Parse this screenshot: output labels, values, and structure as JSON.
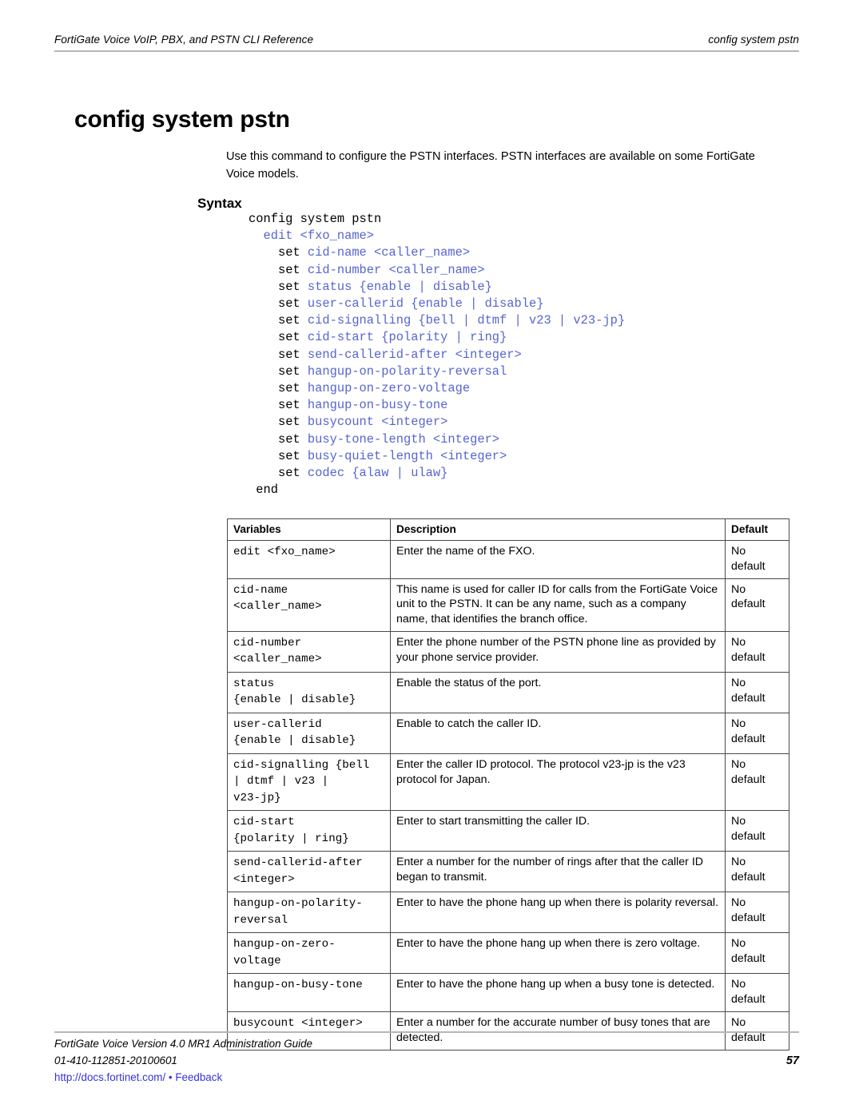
{
  "header": {
    "left": "FortiGate Voice VoIP, PBX, and PSTN CLI Reference",
    "right": "config system pstn"
  },
  "title": "config system pstn",
  "intro": "Use this command to configure the PSTN interfaces. PSTN interfaces are available on some FortiGate Voice models.",
  "syntax_heading": "Syntax",
  "colors": {
    "code_blue": "#5765cf",
    "link_blue": "#3333dd",
    "rule_gray": "#b6b6b6",
    "table_border": "#4a4a4a"
  },
  "syntax": [
    {
      "indent": "",
      "keyword": "config system pstn",
      "rest": ""
    },
    {
      "indent": "  ",
      "keyword": "",
      "rest": "edit <fxo_name>"
    },
    {
      "indent": "    ",
      "keyword": "set ",
      "rest": "cid-name <caller_name>"
    },
    {
      "indent": "    ",
      "keyword": "set ",
      "rest": "cid-number <caller_name>"
    },
    {
      "indent": "    ",
      "keyword": "set ",
      "rest": "status {enable | disable}"
    },
    {
      "indent": "    ",
      "keyword": "set ",
      "rest": "user-callerid {enable | disable}"
    },
    {
      "indent": "    ",
      "keyword": "set ",
      "rest": "cid-signalling {bell | dtmf | v23 | v23-jp}"
    },
    {
      "indent": "    ",
      "keyword": "set ",
      "rest": "cid-start {polarity | ring}"
    },
    {
      "indent": "    ",
      "keyword": "set ",
      "rest": "send-callerid-after <integer>"
    },
    {
      "indent": "    ",
      "keyword": "set ",
      "rest": "hangup-on-polarity-reversal"
    },
    {
      "indent": "    ",
      "keyword": "set ",
      "rest": "hangup-on-zero-voltage"
    },
    {
      "indent": "    ",
      "keyword": "set ",
      "rest": "hangup-on-busy-tone"
    },
    {
      "indent": "    ",
      "keyword": "set ",
      "rest": "busycount <integer>"
    },
    {
      "indent": "    ",
      "keyword": "set ",
      "rest": "busy-tone-length <integer>"
    },
    {
      "indent": "    ",
      "keyword": "set ",
      "rest": "busy-quiet-length <integer>"
    },
    {
      "indent": "    ",
      "keyword": "set ",
      "rest": "codec {alaw | ulaw}"
    },
    {
      "indent": " ",
      "keyword": "end",
      "rest": ""
    }
  ],
  "table": {
    "columns": [
      "Variables",
      "Description",
      "Default"
    ],
    "rows": [
      {
        "variable": "edit <fxo_name>",
        "description": "Enter the name of the FXO.",
        "default": "No\ndefault"
      },
      {
        "variable": "cid-name\n<caller_name>",
        "description": "This name is used for caller ID for calls from the FortiGate Voice unit to the PSTN. It can be any name, such as a company name, that identifies the branch office.",
        "default": "No\ndefault"
      },
      {
        "variable": "cid-number\n<caller_name>",
        "description": "Enter the phone number of the PSTN phone line as provided by your phone service provider.",
        "default": "No\ndefault"
      },
      {
        "variable": "status\n{enable | disable}",
        "description": "Enable the status of the port.",
        "default": "No\ndefault"
      },
      {
        "variable": "user-callerid\n{enable | disable}",
        "description": "Enable to catch the caller ID.",
        "default": "No\ndefault"
      },
      {
        "variable": "cid-signalling {bell\n| dtmf | v23 |\nv23-jp}",
        "description": "Enter the caller ID protocol. The protocol v23-jp is the v23 protocol for Japan.",
        "default": "No\ndefault"
      },
      {
        "variable": "cid-start\n{polarity | ring}",
        "description": "Enter to start transmitting the caller ID.",
        "default": "No\ndefault"
      },
      {
        "variable": "send-callerid-after\n<integer>",
        "description": "Enter a number for the number of rings after that the caller ID began to transmit.",
        "default": "No\ndefault"
      },
      {
        "variable": "hangup-on-polarity-\nreversal",
        "description": "Enter to have the phone hang up when there is polarity reversal.",
        "default": "No\ndefault"
      },
      {
        "variable": "hangup-on-zero-\nvoltage",
        "description": "Enter to have the phone hang up when there is zero voltage.",
        "default": "No\ndefault"
      },
      {
        "variable": "hangup-on-busy-tone",
        "description": "Enter to have the phone hang up when a busy tone is detected.",
        "default": "No\ndefault"
      },
      {
        "variable": "busycount <integer>",
        "description": "Enter a number for the accurate number of busy tones that are detected.",
        "default": "No\ndefault"
      }
    ]
  },
  "footer": {
    "guide": "FortiGate Voice Version 4.0 MR1 Administration Guide",
    "doc_id": "01-410-112851-20100601",
    "page_number": "57",
    "url": "http://docs.fortinet.com/",
    "separator": "•",
    "feedback": "Feedback"
  }
}
